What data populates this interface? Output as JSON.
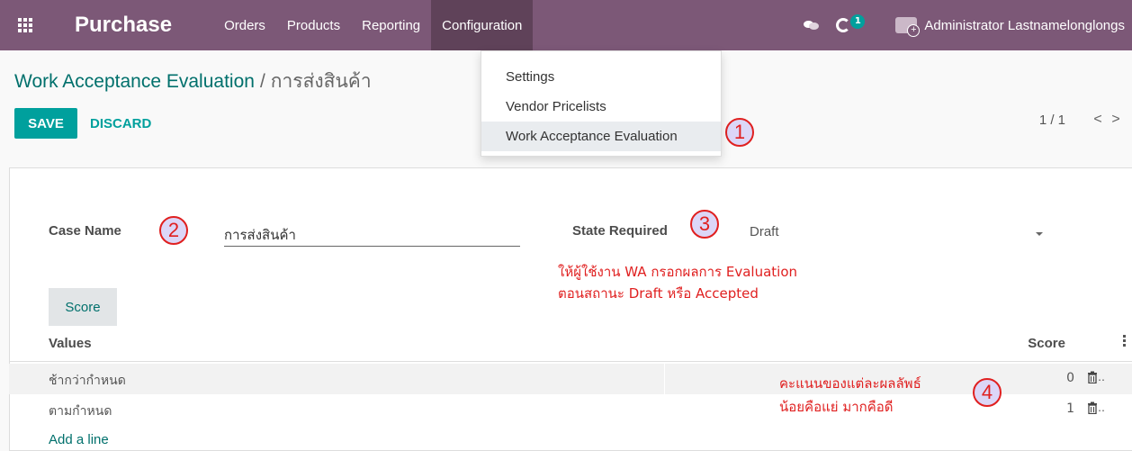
{
  "navbar": {
    "app_name": "Purchase",
    "menu": [
      "Orders",
      "Products",
      "Reporting",
      "Configuration"
    ],
    "activity_count": "1",
    "user_name": "Administrator Lastnamelonglongs"
  },
  "breadcrumb": {
    "parent": "Work Acceptance Evaluation",
    "separator": "/",
    "current": "การส่งสินค้า"
  },
  "actions": {
    "save": "SAVE",
    "discard": "DISCARD"
  },
  "pager": {
    "value": "1 / 1",
    "prev": "<",
    "next": ">"
  },
  "dropdown": {
    "items": [
      "Settings",
      "Vendor Pricelists",
      "Work Acceptance Evaluation"
    ],
    "active_index": 2
  },
  "form": {
    "case_name_label": "Case Name",
    "case_name_value": "การส่งสินค้า",
    "state_label": "State Required",
    "state_value": "Draft"
  },
  "annotations": {
    "markers": [
      "1",
      "2",
      "3",
      "4"
    ],
    "state_note": [
      "ให้ผู้ใช้งาน WA กรอกผลการ Evaluation",
      "ตอนสถานะ Draft หรือ Accepted"
    ],
    "score_note": [
      "คะแนนของแต่ละผลลัพธ์",
      "น้อยคือแย่ มากคือดี"
    ]
  },
  "tab": {
    "label": "Score"
  },
  "table": {
    "columns": [
      "Values",
      "Score"
    ],
    "rows": [
      {
        "value": "ช้ากว่ากำหนด",
        "score": "0"
      },
      {
        "value": "ตามกำหนด",
        "score": "1"
      }
    ],
    "add_line": "Add a line"
  },
  "colors": {
    "navbar": "#7c5877",
    "accent": "#00a09d",
    "link": "#00706c",
    "annotation": "#e02020"
  }
}
